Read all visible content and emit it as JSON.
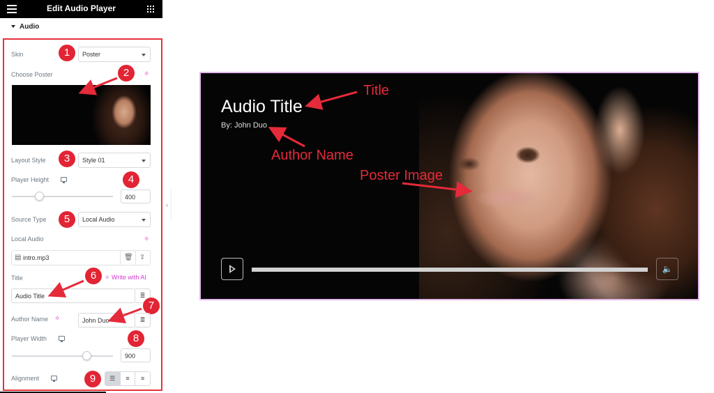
{
  "header": {
    "title": "Edit Audio Player",
    "menu_icon": "hamburger-icon",
    "apps_icon": "grid-icon"
  },
  "section": {
    "title": "Audio"
  },
  "controls": {
    "skin": {
      "label": "Skin",
      "value": "Poster"
    },
    "choose_poster": {
      "label": "Choose Poster"
    },
    "layout_style": {
      "label": "Layout Style",
      "value": "Style 01"
    },
    "player_height": {
      "label": "Player Height",
      "value": "400"
    },
    "source_type": {
      "label": "Source Type",
      "value": "Local Audio"
    },
    "local_audio": {
      "label": "Local Audio",
      "file": "intro.mp3"
    },
    "title": {
      "label": "Title",
      "ai_label": "Write with AI",
      "value": "Audio Title"
    },
    "author_name": {
      "label": "Author Name",
      "value": "John Duo"
    },
    "player_width": {
      "label": "Player Width",
      "value": "900"
    },
    "alignment": {
      "label": "Alignment",
      "options": [
        "left",
        "center",
        "right"
      ],
      "selected": "left"
    }
  },
  "badges": [
    "1",
    "2",
    "3",
    "4",
    "5",
    "6",
    "7",
    "8",
    "9"
  ],
  "player": {
    "title": "Audio Title",
    "author": "By: John Duo",
    "progress": 0
  },
  "annotations": {
    "title": "Title",
    "author": "Author Name",
    "poster": "Poster Image"
  },
  "colors": {
    "accent": "#e22434",
    "ai": "#d63bd1",
    "frame": "#e6b8ef"
  }
}
